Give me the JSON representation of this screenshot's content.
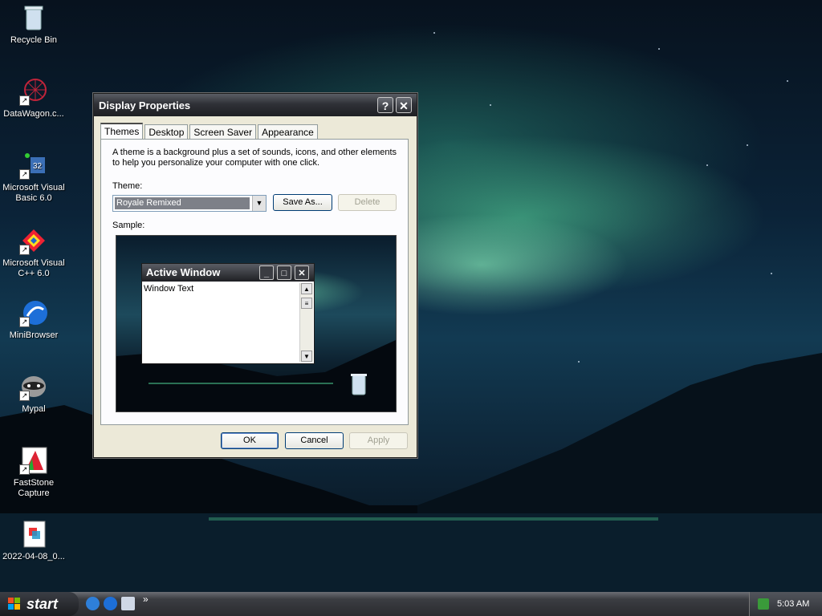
{
  "desktop_icons": [
    {
      "label": "Recycle Bin",
      "icon": "recycle-bin-icon"
    },
    {
      "label": "DataWagon.c...",
      "icon": "datawagon-icon"
    },
    {
      "label": "Microsoft Visual Basic 6.0",
      "icon": "visual-basic-icon"
    },
    {
      "label": "Microsoft Visual C++ 6.0",
      "icon": "visual-cpp-icon"
    },
    {
      "label": "MiniBrowser",
      "icon": "minibrowser-icon"
    },
    {
      "label": "Mypal",
      "icon": "mypal-icon"
    },
    {
      "label": "FastStone Capture",
      "icon": "faststone-icon"
    },
    {
      "label": "2022-04-08_0...",
      "icon": "image-file-icon"
    }
  ],
  "dialog": {
    "title": "Display Properties",
    "help_glyph": "?",
    "close_glyph": "✕",
    "tabs": [
      "Themes",
      "Desktop",
      "Screen Saver",
      "Appearance"
    ],
    "active_tab": "Themes",
    "description": "A theme is a background plus a set of sounds, icons, and other elements to help you personalize your computer with one click.",
    "theme_label": "Theme:",
    "theme_value": "Royale Remixed",
    "save_as": "Save As...",
    "delete": "Delete",
    "sample_label": "Sample:",
    "sample_window_title": "Active Window",
    "sample_window_text": "Window Text",
    "ok": "OK",
    "cancel": "Cancel",
    "apply": "Apply"
  },
  "taskbar": {
    "start_label": "start",
    "quick_launch": [
      "internet-explorer-icon",
      "minibrowser-icon",
      "show-desktop-icon"
    ],
    "expand_glyph": "»",
    "clock": "5:03 AM"
  },
  "colors": {
    "dialog_face": "#ece9d8",
    "titlebar_dark": "#1e1f23",
    "selection": "#7d8088"
  }
}
